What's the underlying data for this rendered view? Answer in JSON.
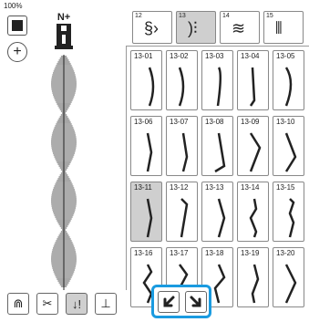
{
  "zoom_level": "100%",
  "foot_label": "N+",
  "tabs": [
    {
      "num": "12",
      "glyph": "ꟹ"
    },
    {
      "num": "13",
      "glyph": ")⫶"
    },
    {
      "num": "14",
      "glyph": "≋"
    },
    {
      "num": "15",
      "glyph": "⫴"
    }
  ],
  "selected_tab": "13",
  "patterns": [
    "13-01",
    "13-02",
    "13-03",
    "13-04",
    "13-05",
    "13-06",
    "13-07",
    "13-08",
    "13-09",
    "13-10",
    "13-11",
    "13-12",
    "13-13",
    "13-14",
    "13-15",
    "13-16",
    "13-17",
    "13-18",
    "13-19",
    "13-20"
  ],
  "selected_pattern": "13-11",
  "colors": {
    "accent": "#1a9be0",
    "selected_bg": "#cfcfcf"
  }
}
